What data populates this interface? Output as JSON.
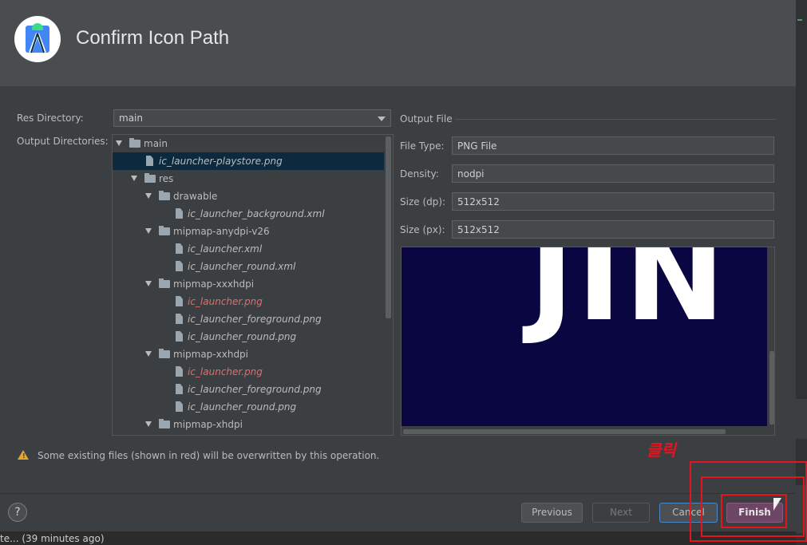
{
  "dialog": {
    "title": "Confirm Icon Path",
    "res_directory_label": "Res Directory:",
    "res_directory_value": "main",
    "output_directories_label": "Output Directories:",
    "tree": [
      {
        "label": "main",
        "type": "folder",
        "red": false,
        "selected": false
      },
      {
        "label": "ic_launcher-playstore.png",
        "type": "file",
        "red": false,
        "selected": true
      },
      {
        "label": "res",
        "type": "folder",
        "red": false,
        "selected": false
      },
      {
        "label": "drawable",
        "type": "folder",
        "red": false,
        "selected": false
      },
      {
        "label": "ic_launcher_background.xml",
        "type": "file",
        "red": false,
        "selected": false
      },
      {
        "label": "mipmap-anydpi-v26",
        "type": "folder",
        "red": false,
        "selected": false
      },
      {
        "label": "ic_launcher.xml",
        "type": "file",
        "red": false,
        "selected": false
      },
      {
        "label": "ic_launcher_round.xml",
        "type": "file",
        "red": false,
        "selected": false
      },
      {
        "label": "mipmap-xxxhdpi",
        "type": "folder",
        "red": false,
        "selected": false
      },
      {
        "label": "ic_launcher.png",
        "type": "file",
        "red": true,
        "selected": false
      },
      {
        "label": "ic_launcher_foreground.png",
        "type": "file",
        "red": false,
        "selected": false
      },
      {
        "label": "ic_launcher_round.png",
        "type": "file",
        "red": false,
        "selected": false
      },
      {
        "label": "mipmap-xxhdpi",
        "type": "folder",
        "red": false,
        "selected": false
      },
      {
        "label": "ic_launcher.png",
        "type": "file",
        "red": true,
        "selected": false
      },
      {
        "label": "ic_launcher_foreground.png",
        "type": "file",
        "red": false,
        "selected": false
      },
      {
        "label": "ic_launcher_round.png",
        "type": "file",
        "red": false,
        "selected": false
      },
      {
        "label": "mipmap-xhdpi",
        "type": "folder",
        "red": false,
        "selected": false
      }
    ],
    "output_file": {
      "section_label": "Output File",
      "file_type_label": "File Type:",
      "file_type_value": "PNG File",
      "density_label": "Density:",
      "density_value": "nodpi",
      "size_dp_label": "Size (dp):",
      "size_dp_value": "512x512",
      "size_px_label": "Size (px):",
      "size_px_value": "512x512",
      "preview_text": "JIN",
      "preview_bg": "#0a0642"
    },
    "warning": "Some existing files (shown in red) will be overwritten by this operation.",
    "annotation": "클릭",
    "buttons": {
      "help": "?",
      "previous": "Previous",
      "next": "Next",
      "cancel": "Cancel",
      "finish": "Finish"
    }
  },
  "status_bar": {
    "text": "te... (39 minutes ago)"
  },
  "colors": {
    "accent_red": "#e5141e",
    "overwrite_red": "#e06c6c",
    "finish_button": "#6d4665",
    "selection": "#0d293e"
  },
  "icons": [
    "android-studio-logo-icon",
    "folder-icon",
    "file-icon",
    "warning-icon",
    "help-icon",
    "chevron-down-icon",
    "mouse-cursor-icon"
  ]
}
